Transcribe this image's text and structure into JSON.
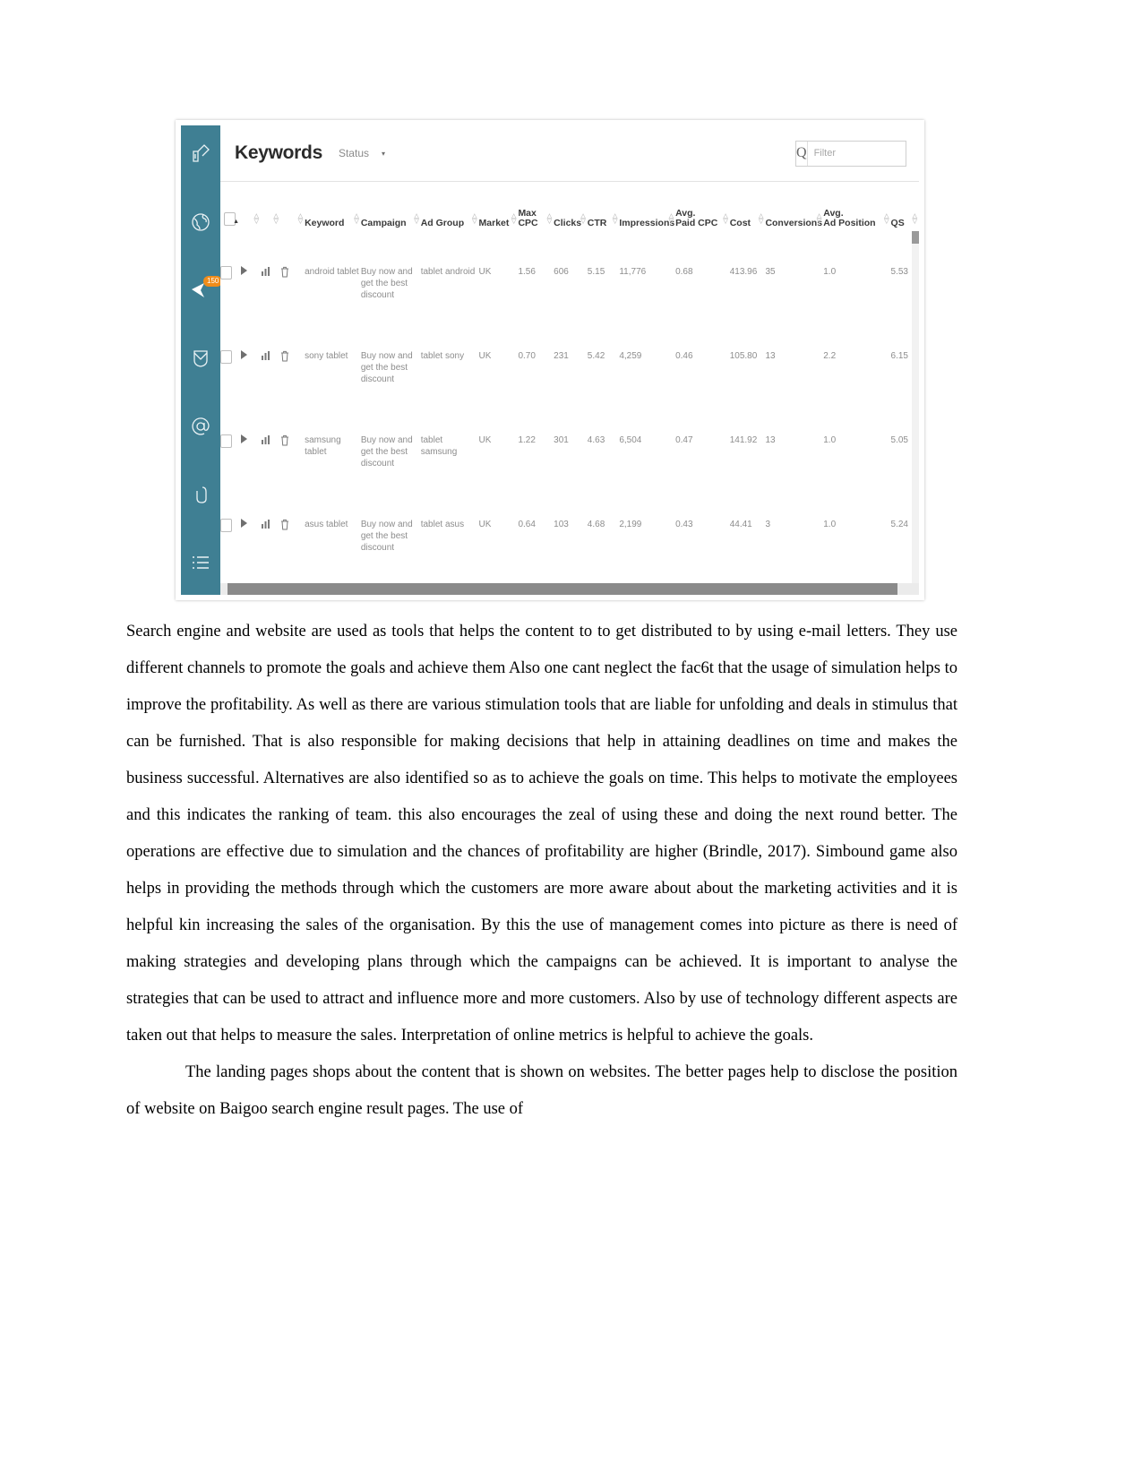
{
  "screenshot": {
    "app": {
      "sidebar": {
        "items": [
          {
            "name": "pencil-edit-icon",
            "badge": ""
          },
          {
            "name": "globe-icon",
            "badge": ""
          },
          {
            "name": "location-pin-icon",
            "badge": "150"
          },
          {
            "name": "inbox-envelope-icon",
            "badge": ""
          },
          {
            "name": "at-sign-icon",
            "badge": ""
          },
          {
            "name": "paperclip-icon",
            "badge": ""
          },
          {
            "name": "list-icon",
            "badge": ""
          }
        ]
      },
      "header": {
        "title": "Keywords",
        "status_label": "Status",
        "status_caret": "▾"
      },
      "search": {
        "icon": "search-icon",
        "glyph": "Q",
        "placeholder": "Filter",
        "value": ""
      },
      "table": {
        "columns": [
          {
            "label": "",
            "key": "check"
          },
          {
            "label": "",
            "key": "expand"
          },
          {
            "label": "",
            "key": "chart"
          },
          {
            "label": "",
            "key": "delete"
          },
          {
            "label": "Keyword",
            "key": "keyword"
          },
          {
            "label": "Campaign",
            "key": "campaign"
          },
          {
            "label": "Ad Group",
            "key": "adgroup"
          },
          {
            "label": "Market",
            "key": "market"
          },
          {
            "label": "Max\nCPC",
            "line1": "Max",
            "line2": "CPC",
            "key": "maxcpc"
          },
          {
            "label": "Clicks",
            "key": "clicks"
          },
          {
            "label": "CTR",
            "key": "ctr"
          },
          {
            "label": "Impressions",
            "key": "impressions"
          },
          {
            "label": "Avg.\nPaid CPC",
            "line1": "Avg.",
            "line2": "Paid CPC",
            "key": "avgpaidcpc"
          },
          {
            "label": "Cost",
            "key": "cost"
          },
          {
            "label": "Conversions",
            "key": "conversions"
          },
          {
            "label": "Avg.\nAd Position",
            "line1": "Avg.",
            "line2": "Ad Position",
            "key": "avgadposition"
          },
          {
            "label": "QS",
            "key": "qs"
          }
        ],
        "rows": [
          {
            "keyword": "android tablet",
            "campaign": "Buy now and get the best discount",
            "adgroup": "tablet android",
            "market": "UK",
            "maxcpc": "1.56",
            "clicks": "606",
            "ctr": "5.15",
            "impressions": "11,776",
            "avgpaidcpc": "0.68",
            "cost": "413.96",
            "conversions": "35",
            "avgadposition": "1.0",
            "qs": "5.53"
          },
          {
            "keyword": "sony tablet",
            "campaign": "Buy now and get the best discount",
            "adgroup": "tablet sony",
            "market": "UK",
            "maxcpc": "0.70",
            "clicks": "231",
            "ctr": "5.42",
            "impressions": "4,259",
            "avgpaidcpc": "0.46",
            "cost": "105.80",
            "conversions": "13",
            "avgadposition": "2.2",
            "qs": "6.15"
          },
          {
            "keyword": "samsung tablet",
            "campaign": "Buy now and get the best discount",
            "adgroup": "tablet samsung",
            "market": "UK",
            "maxcpc": "1.22",
            "clicks": "301",
            "ctr": "4.63",
            "impressions": "6,504",
            "avgpaidcpc": "0.47",
            "cost": "141.92",
            "conversions": "13",
            "avgadposition": "1.0",
            "qs": "5.05"
          },
          {
            "keyword": "asus tablet",
            "campaign": "Buy now and get the best discount",
            "adgroup": "tablet asus",
            "market": "UK",
            "maxcpc": "0.64",
            "clicks": "103",
            "ctr": "4.68",
            "impressions": "2,199",
            "avgpaidcpc": "0.43",
            "cost": "44.41",
            "conversions": "3",
            "avgadposition": "1.0",
            "qs": "5.24"
          }
        ]
      },
      "colors": {
        "rail": "#3f7f93",
        "badge": "#f08c1a",
        "maxcpc_text": "#d8ab2f",
        "divider": "#8a8a8a"
      }
    }
  },
  "document": {
    "paragraphs": [
      "Search engine and website are used as tools that helps the content to to get distributed to by using e-mail letters. They use different channels to promote the goals and achieve them Also one cant neglect the fac6t that the usage of simulation helps to improve the profitability. As well as there are various stimulation tools that are liable for unfolding and deals in stimulus that can be furnished. That is also responsible for making decisions that help in attaining deadlines on time and makes the business successful. Alternatives are also identified so as to achieve the goals on time. This helps to motivate the employees and this indicates the ranking of team. this also encourages the zeal of using these and doing the next round better. The operations are effective due to simulation and the chances of profitability are higher (Brindle, 2017). Simbound game also helps in providing the methods through which the customers are more aware about about the marketing activities and it is helpful kin increasing the sales of the organisation. By this the use of management comes into picture as there is need of making strategies and developing plans through which the campaigns can be achieved. It is important to analyse the strategies that can be used to attract and influence more and more customers. Also by use of technology different aspects are taken out that helps to measure the sales. Interpretation of online metrics is helpful to achieve the goals.",
      "The landing pages shops about the content that is shown on websites. The better pages help to disclose the position of website on Baigoo search engine result pages. The use of"
    ]
  }
}
